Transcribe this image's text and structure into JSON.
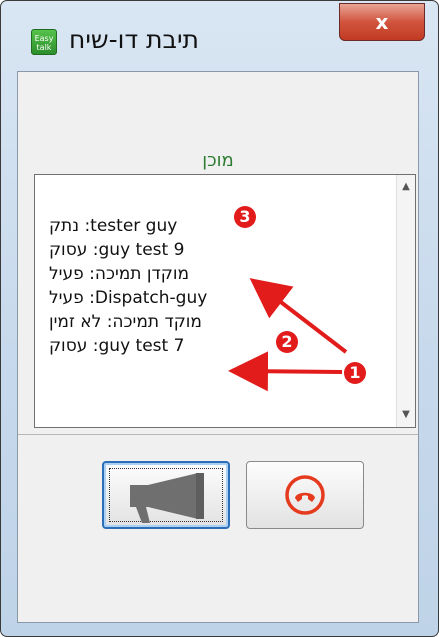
{
  "window": {
    "title": "תיבת דו-שיח",
    "logo_text": "Easy talk",
    "close_label": "x"
  },
  "status": {
    "text": "מוכן",
    "color": "#2e7d32"
  },
  "contacts": [
    {
      "text": "tester guy: נתק"
    },
    {
      "text": "guy test 9: עסוק"
    },
    {
      "text": "מוקדן תמיכה: פעיל"
    },
    {
      "text": "Dispatch-guy: פעיל"
    },
    {
      "text": "מוקד תמיכה: לא זמין"
    },
    {
      "text": "guy test 7: עסוק"
    }
  ],
  "buttons": {
    "talk_icon": "megaphone-icon",
    "hangup_icon": "phone-hangup-icon"
  },
  "annotations": {
    "marker_1": "1",
    "marker_2": "2",
    "marker_3": "3",
    "color": "#e21b1b"
  }
}
